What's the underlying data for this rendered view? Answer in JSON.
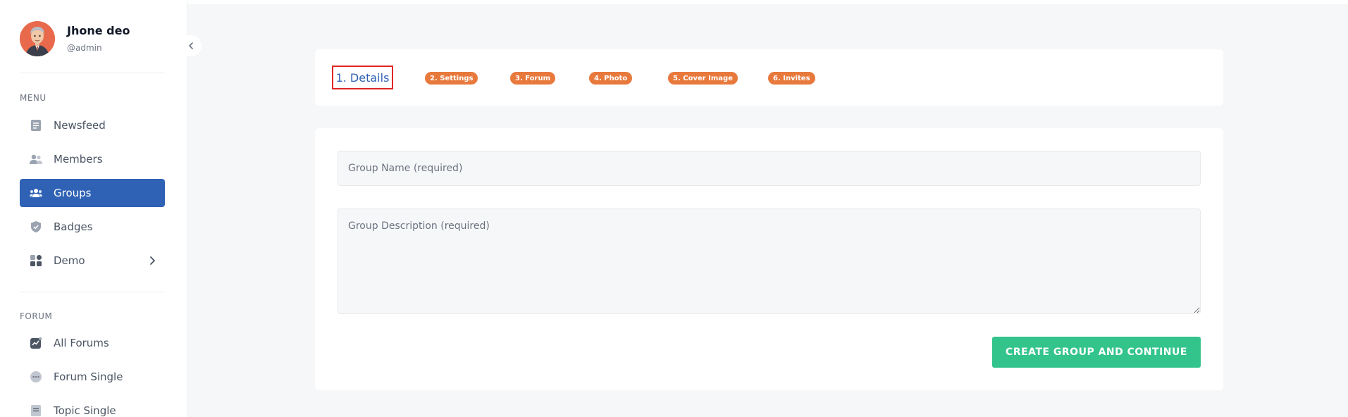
{
  "profile": {
    "name": "Jhone deo",
    "handle": "@admin"
  },
  "menu": {
    "title": "MENU",
    "items": [
      {
        "label": "Newsfeed",
        "icon": "document-icon"
      },
      {
        "label": "Members",
        "icon": "members-icon"
      },
      {
        "label": "Groups",
        "icon": "groups-icon",
        "active": true
      },
      {
        "label": "Badges",
        "icon": "shield-icon"
      },
      {
        "label": "Demo",
        "icon": "grid-icon",
        "has_submenu": true
      }
    ]
  },
  "forum": {
    "title": "FORUM",
    "items": [
      {
        "label": "All Forums",
        "icon": "forum-chart-icon"
      },
      {
        "label": "Forum Single",
        "icon": "chat-bubble-icon"
      },
      {
        "label": "Topic Single",
        "icon": "topic-document-icon"
      }
    ]
  },
  "steps": [
    {
      "label": "1. Details",
      "active": true
    },
    {
      "label": "2. Settings"
    },
    {
      "label": "3. Forum"
    },
    {
      "label": "4. Photo"
    },
    {
      "label": "5. Cover Image"
    },
    {
      "label": "6. Invites"
    }
  ],
  "form": {
    "name_placeholder": "Group Name (required)",
    "description_placeholder": "Group Description (required)",
    "submit_label": "CREATE GROUP AND CONTINUE"
  },
  "colors": {
    "accent": "#2f62b5",
    "step_pill": "#e8793d",
    "submit": "#33c48b",
    "active_step_border": "#e32424"
  }
}
